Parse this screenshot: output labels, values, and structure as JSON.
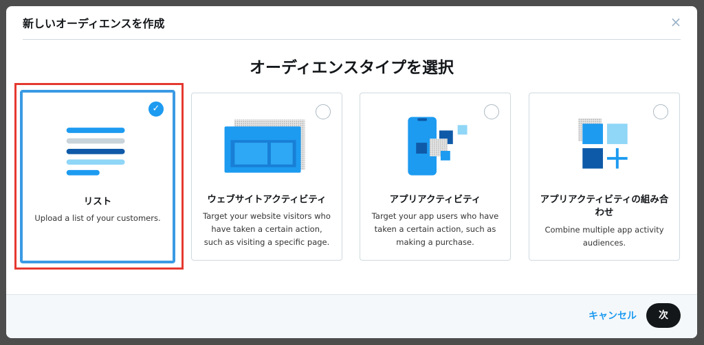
{
  "modal": {
    "title": "新しいオーディエンスを作成",
    "close_icon": "×",
    "section_title": "オーディエンスタイプを選択"
  },
  "cards": [
    {
      "label": "リスト",
      "description": "Upload a list of your customers.",
      "selected": true,
      "icon": "list-icon"
    },
    {
      "label": "ウェブサイトアクティビティ",
      "description": "Target your website visitors who have taken a certain action, such as visiting a specific page.",
      "selected": false,
      "icon": "website-activity-icon"
    },
    {
      "label": "アプリアクティビティ",
      "description": "Target your app users who have taken a certain action, such as making a purchase.",
      "selected": false,
      "icon": "app-activity-icon"
    },
    {
      "label": "アプリアクティビティの組み合わせ",
      "description": "Combine multiple app activity audiences.",
      "selected": false,
      "icon": "app-activity-combination-icon"
    }
  ],
  "footer": {
    "cancel_label": "キャンセル",
    "next_label": "次"
  },
  "colors": {
    "accent": "#1d9bf0",
    "selected_border": "#3a9ae4",
    "highlight_outline": "#e5382f",
    "primary_button": "#14171a"
  }
}
